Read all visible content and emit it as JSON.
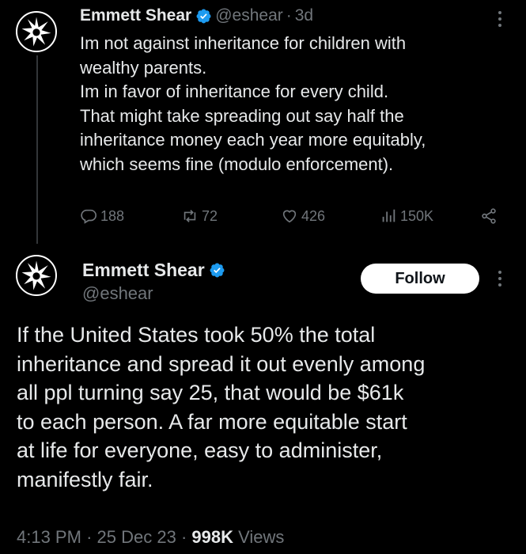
{
  "tweet1": {
    "author_name": "Emmett Shear",
    "handle": "@eshear",
    "separator": "·",
    "time": "3d",
    "lines": [
      "Im not against inheritance for children with",
      "wealthy parents.",
      "Im in favor of inheritance for every child.",
      "That might take spreading out say half the",
      "inheritance money each year more equitably,",
      "which seems fine (modulo enforcement)."
    ],
    "replies": "188",
    "retweets": "72",
    "likes": "426",
    "views": "150K"
  },
  "tweet2": {
    "author_name": "Emmett Shear",
    "handle": "@eshear",
    "follow_label": "Follow",
    "lines": [
      "If the United States took 50% the total",
      "inheritance and spread it out evenly among",
      "all ppl turning say 25, that would be $61k",
      "to each person. A far more equitable start",
      "at life for everyone, easy to administer,",
      "manifestly fair."
    ],
    "time": "4:13 PM",
    "sep1": "·",
    "date": "25 Dec 23",
    "sep2": "·",
    "views": "998K",
    "views_label": "Views"
  },
  "colors": {
    "verified": "#1d9bf0",
    "muted": "#71767b",
    "text": "#e7e9ea"
  }
}
